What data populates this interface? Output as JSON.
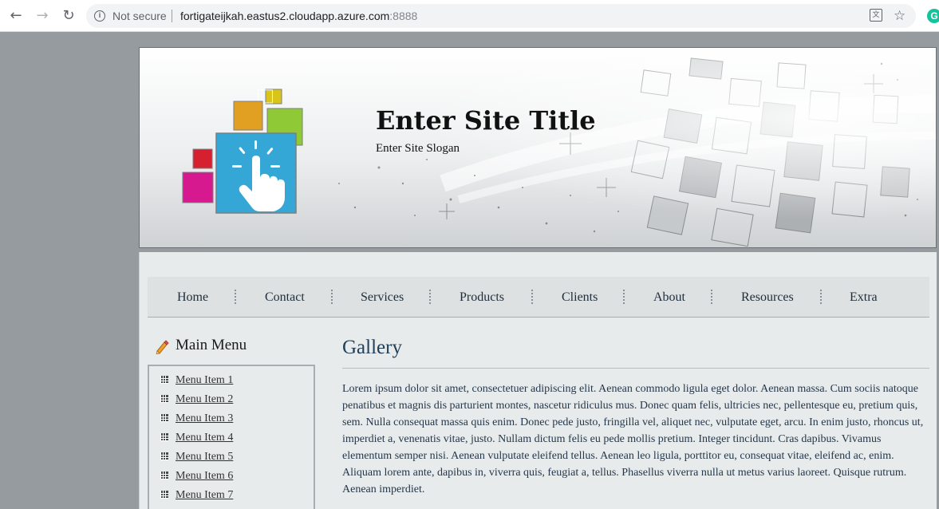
{
  "browser": {
    "back_icon": "arrow-left-icon",
    "forward_icon": "arrow-right-icon",
    "reload_icon": "reload-icon",
    "security_label": "Not secure",
    "url_host": "fortigateijkah.eastus2.cloudapp.azure.com",
    "url_port": ":8888",
    "translate_icon": "translate-icon",
    "bookmark_icon": "star-icon",
    "extension_label": "G"
  },
  "header": {
    "site_title": "Enter Site Title",
    "site_slogan": "Enter Site Slogan",
    "logo_icon": "hand-pointer-icon",
    "logo_colors": [
      "#e2a022",
      "#d9c41a",
      "#8fc936",
      "#22c2c2",
      "#d6202f",
      "#d6198f",
      "#34a7d7"
    ]
  },
  "nav": {
    "items": [
      "Home",
      "Contact",
      "Services",
      "Products",
      "Clients",
      "About",
      "Resources",
      "Extra"
    ]
  },
  "sidebar": {
    "title": "Main Menu",
    "title_icon": "pencil-icon",
    "items": [
      "Menu Item 1",
      "Menu Item 2",
      "Menu Item 3",
      "Menu Item 4",
      "Menu Item 5",
      "Menu Item 6",
      "Menu Item 7"
    ]
  },
  "main": {
    "title": "Gallery",
    "body": "Lorem ipsum dolor sit amet, consectetuer adipiscing elit. Aenean commodo ligula eget dolor. Aenean massa. Cum sociis natoque penatibus et magnis dis parturient montes, nascetur ridiculus mus. Donec quam felis, ultricies nec, pellentesque eu, pretium quis, sem. Nulla consequat massa quis enim. Donec pede justo, fringilla vel, aliquet nec, vulputate eget, arcu. In enim justo, rhoncus ut, imperdiet a, venenatis vitae, justo. Nullam dictum felis eu pede mollis pretium. Integer tincidunt. Cras dapibus. Vivamus elementum semper nisi. Aenean vulputate eleifend tellus. Aenean leo ligula, porttitor eu, consequat vitae, eleifend ac, enim. Aliquam lorem ante, dapibus in, viverra quis, feugiat a, tellus. Phasellus viverra nulla ut metus varius laoreet. Quisque rutrum. Aenean imperdiet."
  }
}
